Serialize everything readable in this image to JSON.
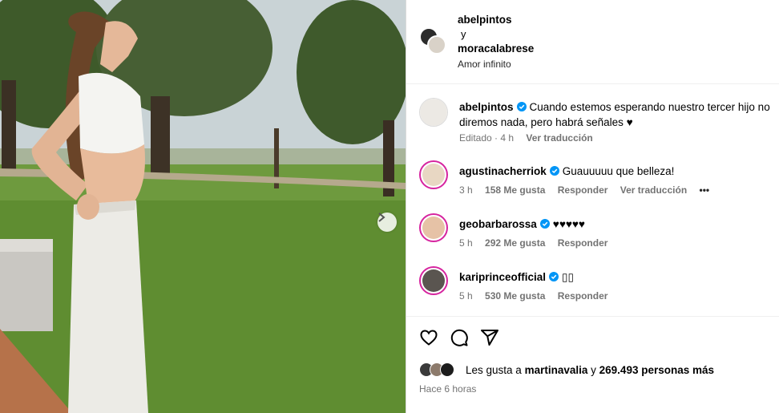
{
  "header": {
    "user1": "abelpintos",
    "connector": "y",
    "user2": "moracalabrese",
    "subtitle": "Amor infinito"
  },
  "caption": {
    "username": "abelpintos",
    "text": "Cuando estemos esperando nuestro tercer hijo no diremos nada, pero habrá señales ♥",
    "edited": "Editado · 4 h",
    "translate": "Ver traducción"
  },
  "comments": [
    {
      "username": "agustinacherriok",
      "text": "Guauuuuu que belleza!",
      "time": "3 h",
      "likes": "158 Me gusta",
      "reply": "Responder",
      "translate": "Ver traducción",
      "more": "•••"
    },
    {
      "username": "geobarbarossa",
      "text": "♥♥♥♥♥",
      "time": "5 h",
      "likes": "292 Me gusta",
      "reply": "Responder"
    },
    {
      "username": "kariprinceofficial",
      "text": "▯▯",
      "time": "5 h",
      "likes": "530 Me gusta",
      "reply": "Responder"
    }
  ],
  "likes": {
    "prefix": "Les gusta a",
    "user": "martinavalia",
    "connector": "y",
    "count": "269.493 personas más"
  },
  "posted": "Hace 6 horas",
  "icons": {
    "like": "heart-icon",
    "comment": "comment-icon",
    "share": "share-icon",
    "next": "chevron-right-icon"
  },
  "colors": {
    "verified": "#0095f6",
    "meta": "#737373",
    "story_ring": "#d6249f"
  }
}
